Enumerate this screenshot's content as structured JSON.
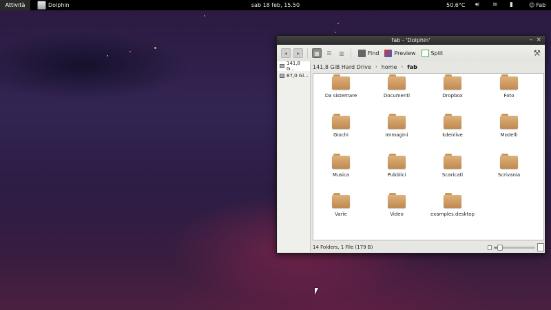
{
  "topbar": {
    "activities": "Attività",
    "app_name": "Dolphin",
    "clock": "sab 18 feb, 15.50",
    "temperature": "50.6°C",
    "user": "Fab",
    "icons": [
      "volume-icon",
      "wifi-icon",
      "battery-icon",
      "user-icon"
    ]
  },
  "window": {
    "title": "fab - 'Dolphin'",
    "toolbar": {
      "find_label": "Find",
      "preview_label": "Preview",
      "split_label": "Split"
    },
    "places": [
      {
        "label": "141,8 G..."
      },
      {
        "label": "87,0 Gi..."
      }
    ],
    "breadcrumb": {
      "root": "141,8 GiB Hard Drive",
      "home": "home",
      "current": "fab"
    },
    "items": [
      {
        "name": "Da sistemare",
        "type": "folder"
      },
      {
        "name": "Documenti",
        "type": "folder"
      },
      {
        "name": "Dropbox",
        "type": "folder"
      },
      {
        "name": "Foto",
        "type": "folder"
      },
      {
        "name": "Giochi",
        "type": "folder"
      },
      {
        "name": "Immagini",
        "type": "folder"
      },
      {
        "name": "kdenlive",
        "type": "folder"
      },
      {
        "name": "Modelli",
        "type": "folder"
      },
      {
        "name": "Musica",
        "type": "folder"
      },
      {
        "name": "Pubblici",
        "type": "folder"
      },
      {
        "name": "Scaricati",
        "type": "folder"
      },
      {
        "name": "Scrivania",
        "type": "folder"
      },
      {
        "name": "Varie",
        "type": "folder"
      },
      {
        "name": "Video",
        "type": "folder"
      },
      {
        "name": "examples.desktop",
        "type": "file"
      }
    ],
    "status": "14 Folders, 1 File (179 B)",
    "zoom_level": 0.15
  }
}
